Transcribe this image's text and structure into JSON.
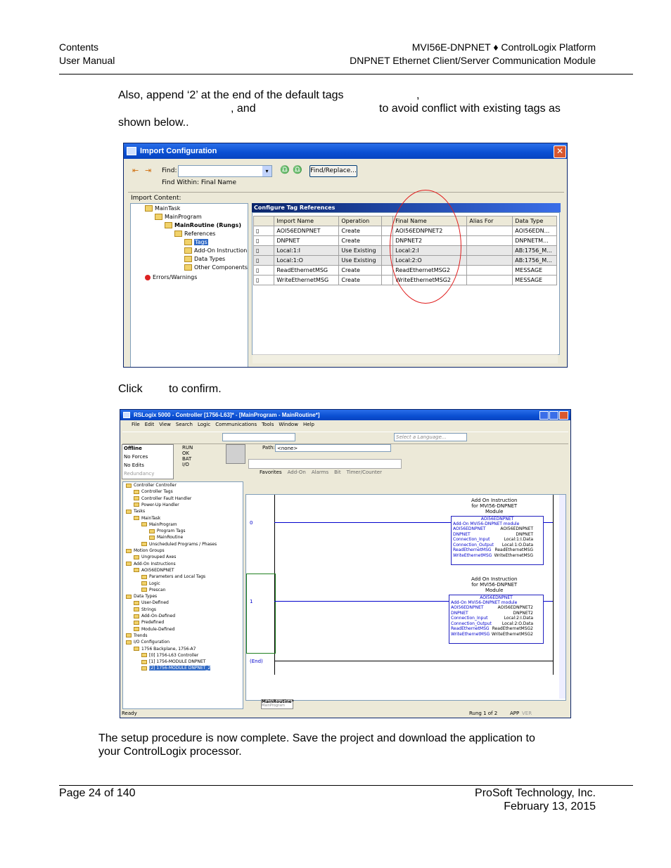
{
  "header": {
    "left_line1": "Contents",
    "left_line2": "User Manual",
    "right_line1": "MVI56E-DNPNET ♦ ControlLogix Platform",
    "right_line2": "DNPNET Ethernet Client/Server Communication Module"
  },
  "intro": {
    "line1": "Also, append ‘2’  at the end of the default tags",
    "line1_comma": ",",
    "line2_a": ", and",
    "line2_b": "to avoid conflict with existing tags as",
    "line3": "shown below.."
  },
  "import_dialog": {
    "title": "Import Configuration",
    "find_label": "Find:",
    "find_within": "Find Within: Final Name",
    "find_replace_button": "Find/Replace...",
    "import_content_label": "Import Content:",
    "tree": [
      "MainTask",
      "MainProgram",
      "MainRoutine (Rungs)",
      "References",
      "Tags",
      "Add-On Instruction",
      "Data Types",
      "Other Components",
      "Errors/Warnings"
    ],
    "section_title": "Configure Tag References",
    "columns": [
      "Import Name",
      "Operation",
      "Final Name",
      "Alias For",
      "Data Type"
    ],
    "rows": [
      {
        "import_name": "AOI56EDNPNET",
        "operation": "Create",
        "final_name": "AOI56EDNPNET2",
        "alias_for": "",
        "data_type": "AOI56EDN..."
      },
      {
        "import_name": "DNPNET",
        "operation": "Create",
        "final_name": "DNPNET2",
        "alias_for": "",
        "data_type": "DNPNETM..."
      },
      {
        "import_name": "Local:1:I",
        "operation": "Use Existing",
        "final_name": "Local:2:I",
        "alias_for": "",
        "data_type": "AB:1756_M..."
      },
      {
        "import_name": "Local:1:O",
        "operation": "Use Existing",
        "final_name": "Local:2:O",
        "alias_for": "",
        "data_type": "AB:1756_M..."
      },
      {
        "import_name": "ReadEthernetMSG",
        "operation": "Create",
        "final_name": "ReadEthernetMSG2",
        "alias_for": "",
        "data_type": "MESSAGE"
      },
      {
        "import_name": "WriteEthernetMSG",
        "operation": "Create",
        "final_name": "WriteEthernetMSG2",
        "alias_for": "",
        "data_type": "MESSAGE"
      }
    ]
  },
  "click_text": {
    "click": "Click",
    "confirm": "to confirm."
  },
  "rslogix": {
    "title": "RSLogix 5000 - Controller [1756-L63]* - [MainProgram - MainRoutine*]",
    "menu": [
      "File",
      "Edit",
      "View",
      "Search",
      "Logic",
      "Communications",
      "Tools",
      "Window",
      "Help"
    ],
    "language_placeholder": "Select a Language...",
    "status_labels": [
      "Offline",
      "No Forces",
      "No Edits",
      "Redundancy"
    ],
    "status_flags": [
      "RUN",
      "OK",
      "BAT",
      "I/O"
    ],
    "path_label": "Path:",
    "path_value": "<none>",
    "instr_tabs": [
      "Favorites",
      "Add-On",
      "Alarms",
      "Bit",
      "Timer/Counter"
    ],
    "tree": [
      "Controller Controller",
      "Controller Tags",
      "Controller Fault Handler",
      "Power-Up Handler",
      "Tasks",
      "MainTask",
      "MainProgram",
      "Program Tags",
      "MainRoutine",
      "Unscheduled Programs / Phases",
      "Motion Groups",
      "Ungrouped Axes",
      "Add-On Instructions",
      "AOI56EDNPNET",
      "Parameters and Local Tags",
      "Logic",
      "Prescan",
      "Data Types",
      "User-Defined",
      "Strings",
      "Add-On-Defined",
      "Predefined",
      "Module-Defined",
      "Trends",
      "I/O Configuration",
      "1756 Backplane, 1756-A7",
      "[0] 1756-L63 Controller",
      "[1] 1756-MODULE DNPNET",
      "[2] 1756-MODULE DNPNET_2"
    ],
    "rungs": [
      {
        "number": "0",
        "caption": [
          "Add On Instruction",
          "for MVI56-DNPNET",
          "Module"
        ],
        "block_title": "AOI56EDNPNET",
        "block_sub": "Add-On MVI56-DNPNET module",
        "params": [
          [
            "AOI56EDNPNET",
            "AOI56EDNPNET"
          ],
          [
            "DNPNET",
            "DNPNET"
          ],
          [
            "Connection_Input",
            "Local:1:I.Data"
          ],
          [
            "Connection_Output",
            "Local:1:O.Data"
          ],
          [
            "ReadEthernetMSG",
            "ReadEthernetMSG"
          ],
          [
            "WriteEthernetMSG",
            "WriteEthernetMSG"
          ]
        ]
      },
      {
        "number": "1",
        "caption": [
          "Add On Instruction",
          "for MVI56-DNPNET",
          "Module"
        ],
        "block_title": "AOI56EDNPNET",
        "block_sub": "Add-On MVI56-DNPNET module",
        "params": [
          [
            "AOI56EDNPNET",
            "AOI56EDNPNET2"
          ],
          [
            "DNPNET",
            "DNPNET2"
          ],
          [
            "Connection_Input",
            "Local:2:I.Data"
          ],
          [
            "Connection_Output",
            "Local:2:O.Data"
          ],
          [
            "ReadEthernetMSG",
            "ReadEthernetMSG2"
          ],
          [
            "WriteEthernetMSG",
            "WriteEthernetMSG2"
          ]
        ]
      }
    ],
    "end_label": "(End)",
    "routine_tab": "MainRoutine*",
    "routine_tab_sub": "MainProgram",
    "status_bar": "Ready",
    "rung_status": "Rung 1 of 2",
    "app_label": "APP",
    "ver_label": "VER"
  },
  "closing": {
    "line1": "The setup procedure is now complete. Save the project and download the application to",
    "line2": "your ControlLogix processor."
  },
  "footer": {
    "page": "Page 24 of 140",
    "company": "ProSoft Technology, Inc.",
    "date": "February 13, 2015"
  }
}
